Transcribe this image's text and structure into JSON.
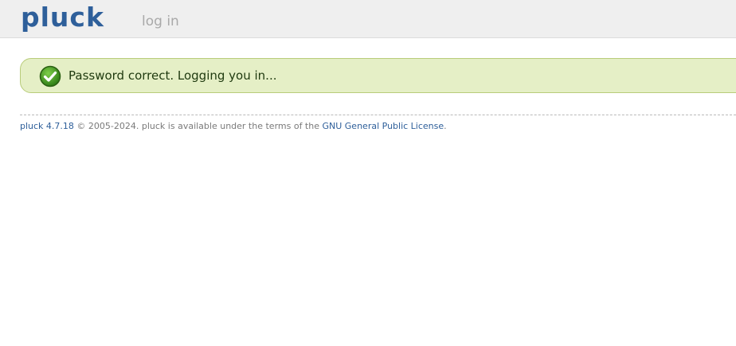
{
  "header": {
    "logo_text": "pluck",
    "page_title": "log in"
  },
  "notice": {
    "icon": "check-circle-icon",
    "message": "Password correct. Logging you in..."
  },
  "footer": {
    "version_link": "pluck 4.7.18",
    "copyright": " © 2005-2024. pluck is available under the terms of the ",
    "license_link": "GNU General Public License",
    "end": "."
  },
  "colors": {
    "brand": "#2e5f9a",
    "notice_bg": "#e5efc6",
    "notice_border": "#b8cc7a",
    "success_icon": "#3f8f1f"
  }
}
